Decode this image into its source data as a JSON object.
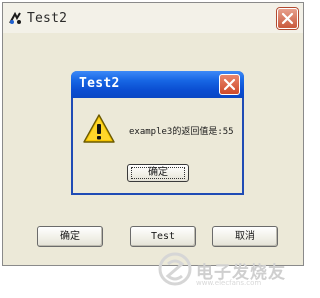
{
  "outer_window": {
    "title": "Test2",
    "buttons": {
      "ok": "确定",
      "test": "Test",
      "cancel": "取消"
    }
  },
  "message_box": {
    "title": "Test2",
    "message": "example3的返回值是:55",
    "ok": "确定",
    "icon": "warning-icon"
  },
  "watermark": {
    "text": "电子发烧友",
    "subtext": "www.elecfans.com"
  },
  "colors": {
    "titlebar_blue": "#0b4ed2",
    "close_red": "#cf4a2a",
    "window_bg": "#ece9d8"
  }
}
